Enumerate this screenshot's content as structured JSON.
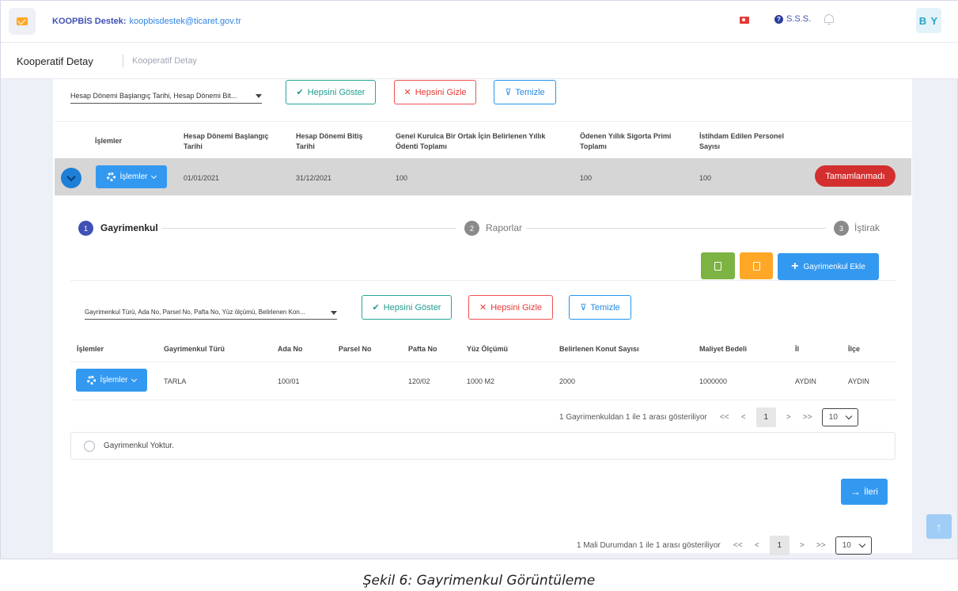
{
  "header": {
    "support_label": "KOOPBİS Destek:",
    "support_email": "koopbisdestek@ticaret.gov.tr",
    "faq": "S.S.S.",
    "avatar": "B Y"
  },
  "breadcrumb": {
    "title": "Kooperatif Detay",
    "sub": "Kooperatif Detay"
  },
  "filters_top": {
    "columns": "Hesap Dönemi Başlangıç Tarihi, Hesap Dönemi Bit...",
    "show_all": "Hepsini Göster",
    "hide_all": "Hepsini Gizle",
    "clear": "Temizle"
  },
  "main_table": {
    "headers": [
      "İşlemler",
      "Hesap Dönemi Başlangıç Tarihi",
      "Hesap Dönemi Bitiş Tarihi",
      "Genel Kurulca Bir Ortak İçin Belirlenen Yıllık Ödenti Toplamı",
      "Ödenen Yıllık Sigorta Primi Toplamı",
      "İstihdam Edilen Personel Sayısı"
    ],
    "row": {
      "actions": "İşlemler",
      "start": "01/01/2021",
      "end": "31/12/2021",
      "fee": "100",
      "insurance": "100",
      "staff": "100",
      "status": "Tamamlanmadı"
    }
  },
  "steps": [
    {
      "num": "1",
      "label": "Gayrimenkul"
    },
    {
      "num": "2",
      "label": "Raporlar"
    },
    {
      "num": "3",
      "label": "İştirak"
    }
  ],
  "colors": {
    "primary": "#3399f0",
    "step_active": "#3f51b5",
    "excel": "#7cb342",
    "pdf": "#ffa726",
    "status": "#d32f2f"
  },
  "toolbar": {
    "add": "Gayrimenkul Ekle",
    "excel_icon": "excel-file-icon",
    "pdf_icon": "pdf-file-icon"
  },
  "filters_inner": {
    "columns": "Gayrimenkul Türü, Ada No, Parsel No, Pafta No, Yüz ölçümü, Belirlenen Kon...",
    "show_all": "Hepsini Göster",
    "hide_all": "Hepsini Gizle",
    "clear": "Temizle"
  },
  "property_table": {
    "headers": [
      "İşlemler",
      "Gayrimenkul Türü",
      "Ada No",
      "Parsel No",
      "Pafta No",
      "Yüz Ölçümü",
      "Belirlenen Konut Sayısı",
      "Maliyet Bedeli",
      "İl",
      "İlçe"
    ],
    "row": {
      "actions": "İşlemler",
      "type": "TARLA",
      "ada": "100/01",
      "parsel": "",
      "pafta": "120/02",
      "area": "1000 M2",
      "units": "2000",
      "cost": "1000000",
      "il": "AYDIN",
      "ilce": "AYDIN"
    }
  },
  "pager_inner": {
    "info": "1 Gayrimenkuldan 1 ile 1 arası gösteriliyor",
    "first": "<<",
    "prev": "<",
    "page": "1",
    "next": ">",
    "last": ">>",
    "size": "10"
  },
  "no_property": "Gayrimenkul Yoktur.",
  "next_button": "İleri",
  "pager_outer": {
    "info": "1 Mali Durumdan 1 ile 1 arası gösteriliyor",
    "first": "<<",
    "prev": "<",
    "page": "1",
    "next": ">",
    "last": ">>",
    "size": "10"
  },
  "caption": "Şekil 6: Gayrimenkul Görüntüleme"
}
